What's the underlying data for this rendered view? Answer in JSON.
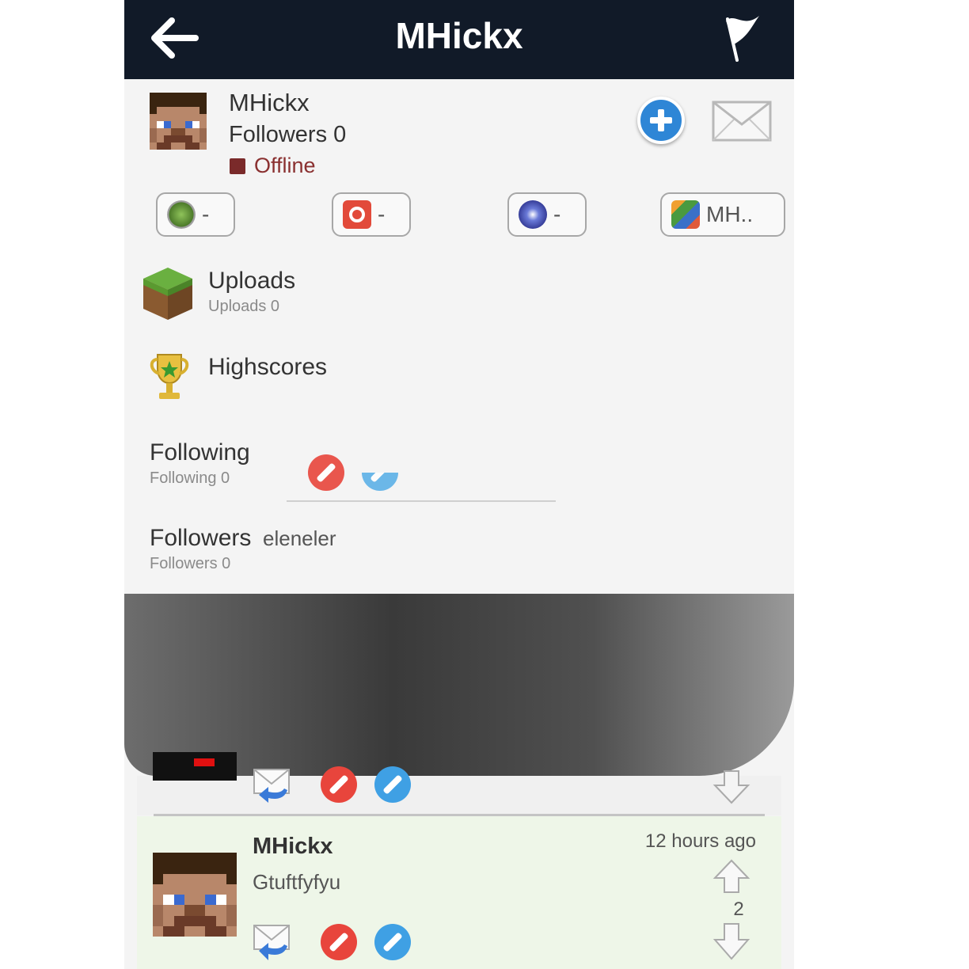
{
  "nav": {
    "title": "MHickx",
    "back_icon": "back-arrow-icon",
    "flag_icon": "flag-icon"
  },
  "profile": {
    "name": "MHickx",
    "followers": "Followers 0",
    "status": "Offline",
    "status_color": "#7a2a2a",
    "follow_icon": "plus-circle-icon",
    "message_icon": "envelope-icon"
  },
  "platforms": [
    {
      "icon": "xbox-icon",
      "value": "-"
    },
    {
      "icon": "origin-icon",
      "value": "-"
    },
    {
      "icon": "playstation-network-icon",
      "value": "-"
    },
    {
      "icon": "game-center-icon",
      "value": "MH.."
    }
  ],
  "menu": {
    "uploads": {
      "title": "Uploads",
      "sub": "Uploads 0",
      "icon": "grass-block-icon"
    },
    "highscores": {
      "title": "Highscores",
      "icon": "trophy-icon"
    },
    "following": {
      "title": "Following",
      "sub": "Following 0"
    },
    "followers": {
      "title": "Followers",
      "sub": "Followers 0"
    }
  },
  "overlay_text": "eleneler",
  "comment": {
    "author": "MHickx",
    "text": "Gtuftfyfyu",
    "time": "12 hours ago",
    "score": "2"
  },
  "colors": {
    "nav_bg": "#111a28",
    "accent_blue": "#2e86d6",
    "ban_red": "#e8453c",
    "comment_bg": "#eef6e8"
  }
}
